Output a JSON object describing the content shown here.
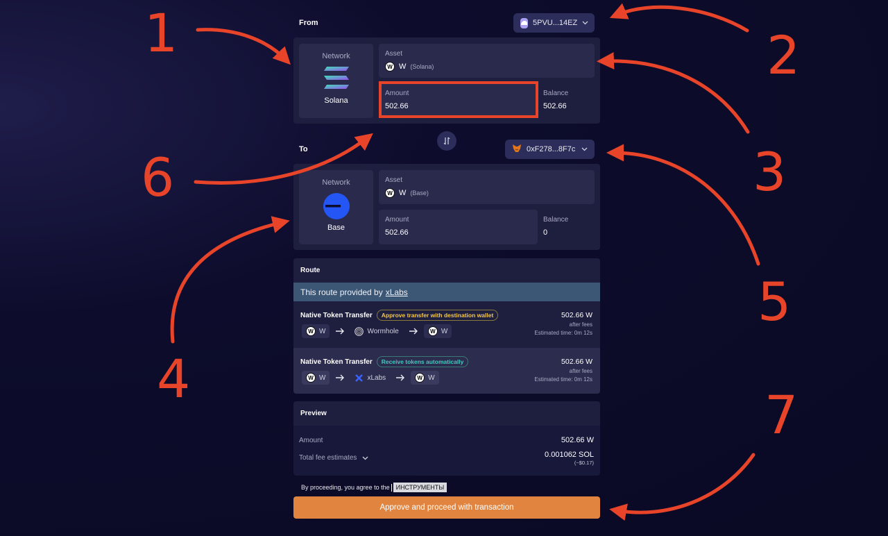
{
  "from": {
    "label": "From",
    "wallet": "5PVU...14EZ",
    "network_label": "Network",
    "network_name": "Solana",
    "asset_label": "Asset",
    "asset_symbol": "W",
    "asset_chain": "(Solana)",
    "amount_label": "Amount",
    "amount_value": "502.66",
    "balance_label": "Balance",
    "balance_value": "502.66"
  },
  "to": {
    "label": "To",
    "wallet": "0xF278...8F7c",
    "network_label": "Network",
    "network_name": "Base",
    "asset_label": "Asset",
    "asset_symbol": "W",
    "asset_chain": "(Base)",
    "amount_label": "Amount",
    "amount_value": "502.66",
    "balance_label": "Balance",
    "balance_value": "0"
  },
  "route": {
    "title": "Route",
    "provider_text": "This route provided by",
    "provider_link": "xLabs",
    "options": [
      {
        "title": "Native Token Transfer",
        "tag": "Approve transfer with destination wallet",
        "from_token": "W",
        "via": "Wormhole",
        "to_token": "W",
        "amount": "502.66 W",
        "after_fees": "after fees",
        "eta": "Estimated time: 0m 12s"
      },
      {
        "title": "Native Token Transfer",
        "tag": "Receive tokens automatically",
        "from_token": "W",
        "via": "xLabs",
        "to_token": "W",
        "amount": "502.66 W",
        "after_fees": "after fees",
        "eta": "Estimated time: 0m 12s"
      }
    ]
  },
  "preview": {
    "title": "Preview",
    "amount_label": "Amount",
    "amount_value": "502.66 W",
    "fee_label": "Total fee estimates",
    "fee_value": "0.001062 SOL",
    "fee_usd": "(~$0.17)"
  },
  "terms_text": "By proceeding, you agree to the",
  "tooltip_text": "ИНСТРУМЕНТЫ",
  "proceed_button": "Approve and proceed with transaction",
  "annotations": [
    "1",
    "2",
    "3",
    "4",
    "5",
    "6",
    "7"
  ],
  "colors": {
    "annotation": "#e8442a",
    "accent_button": "#e0843f",
    "provider_bar": "#3c5676",
    "base_blue": "#2456f5"
  }
}
